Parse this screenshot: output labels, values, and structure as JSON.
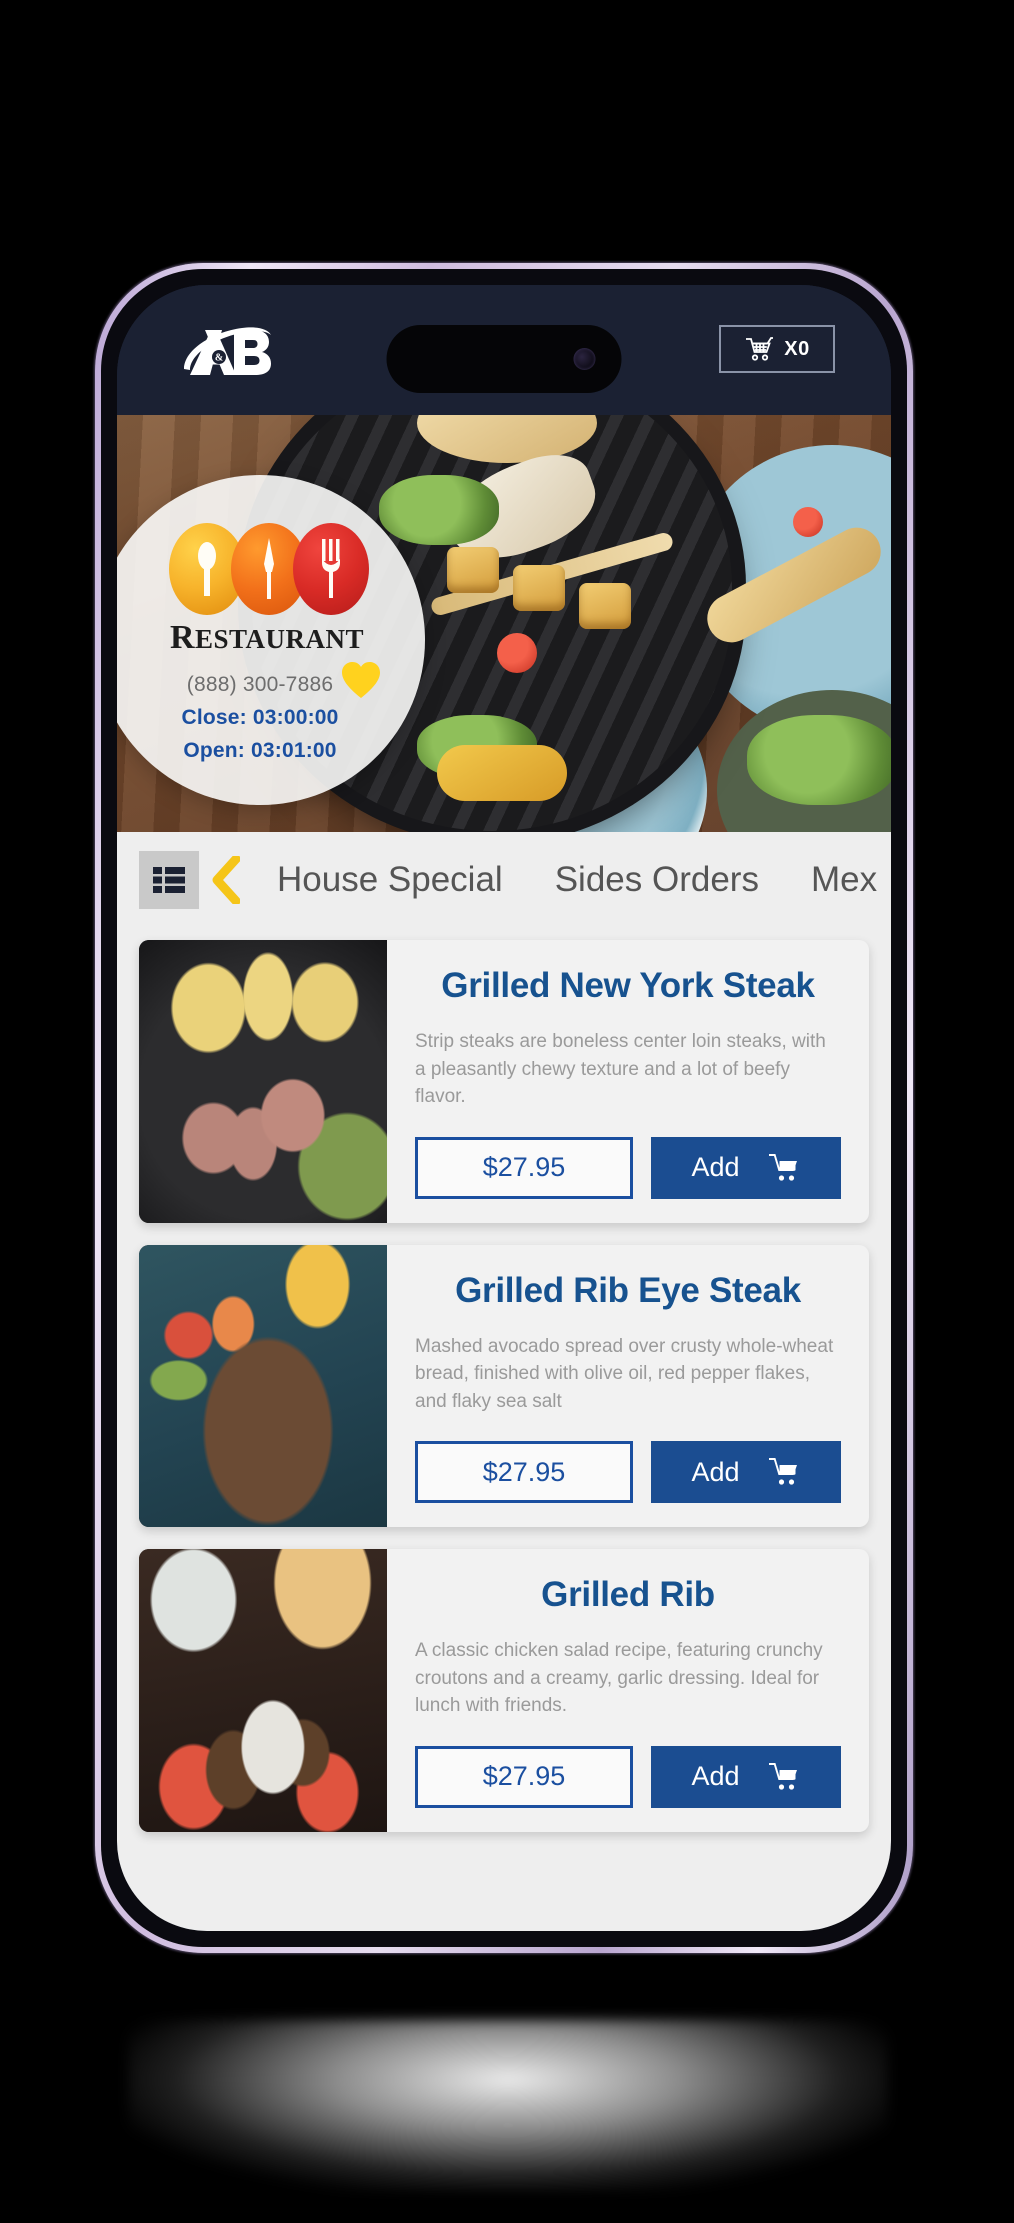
{
  "appbar": {
    "logo_text": "A&B",
    "logo_icon": "ab-swoosh-logo",
    "cart_icon": "shopping-cart-icon",
    "cart_count_label": "X0"
  },
  "hero": {
    "image_alt": "grilled-food-table-banner",
    "badge": {
      "marks_icon": "spoon-knife-fork-circles",
      "name": "Restaurant",
      "name_cap": "R",
      "name_rest": "ESTAURANT",
      "phone": "(888) 300-7886",
      "close_label": "Close: 03:00:00",
      "open_label": "Open: 03:01:00",
      "favorite_icon": "heart-icon",
      "favorite_color": "#ffd21e"
    }
  },
  "tabbar": {
    "grid_icon": "list-view-icon",
    "back_icon": "chevron-left-icon",
    "back_color": "#f5c518",
    "tabs": [
      {
        "label": "House Special"
      },
      {
        "label": "Sides Orders"
      },
      {
        "label": "Mex"
      }
    ]
  },
  "menu": {
    "items": [
      {
        "thumb": "grilled-steak-photo",
        "name": "Grilled New York Steak",
        "description": "Strip steaks are boneless center loin steaks, with a pleasantly chewy texture and a lot of beefy flavor.",
        "price": "$27.95",
        "add_label": "Add",
        "add_icon": "shopping-cart-icon"
      },
      {
        "thumb": "grilled-ribs-photo",
        "name": "Grilled Rib Eye Steak",
        "description": "Mashed avocado spread over crusty whole-wheat bread, finished with olive oil, red pepper flakes, and flaky sea salt",
        "price": "$27.95",
        "add_label": "Add",
        "add_icon": "shopping-cart-icon"
      },
      {
        "thumb": "grilled-rib-platter-photo",
        "name": "Grilled Rib",
        "description": "A classic chicken salad recipe, featuring crunchy croutons and a creamy, garlic dressing. Ideal for lunch with friends.",
        "price": "$27.95",
        "add_label": "Add",
        "add_icon": "shopping-cart-icon"
      }
    ]
  },
  "theme": {
    "appbar_bg": "#1b2133",
    "accent_blue": "#1b4d91",
    "title_blue": "#17528f",
    "page_bg": "#eeeeee"
  }
}
